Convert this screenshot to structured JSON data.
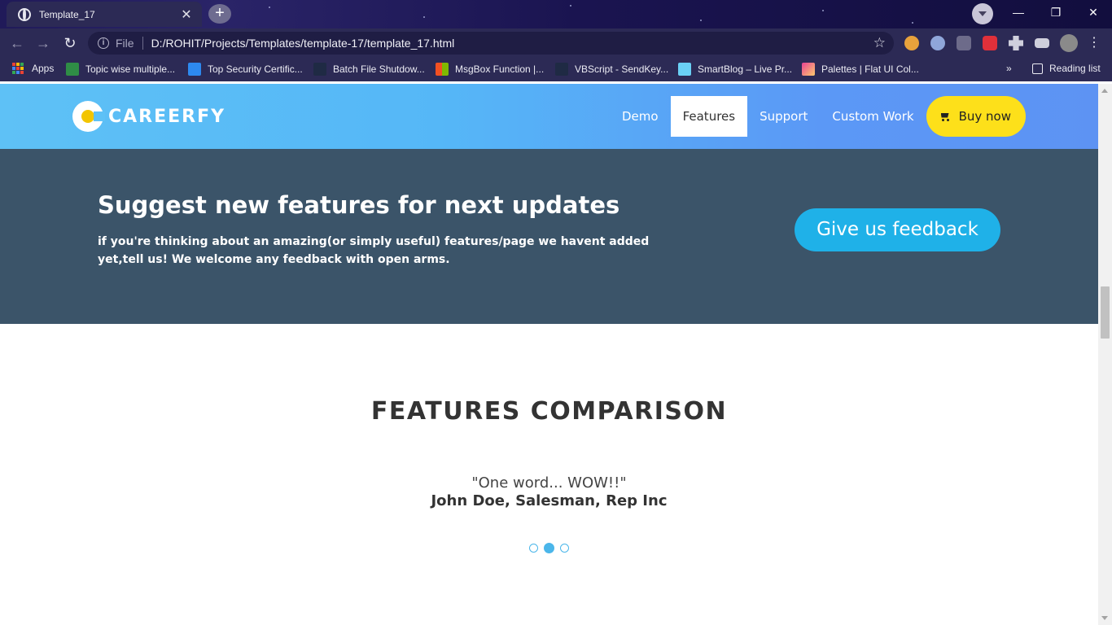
{
  "browser": {
    "tab_title": "Template_17",
    "tab_close": "✕",
    "new_tab": "+",
    "omnibox_file": "File",
    "url": "D:/ROHIT/Projects/Templates/template-17/template_17.html",
    "window_controls": [
      "—",
      "❐",
      "✕"
    ],
    "bookmarks": [
      {
        "label": "Apps",
        "icon": "apps-grid-icon",
        "color": "#e94235"
      },
      {
        "label": "Topic wise multiple...",
        "icon": "gfg-icon",
        "color": "#2f8d46"
      },
      {
        "label": "Top Security Certific...",
        "icon": "certificate-icon",
        "color": "#2d89ef"
      },
      {
        "label": "Batch File Shutdow...",
        "icon": "file-icon",
        "color": "#1f2a44"
      },
      {
        "label": "MsgBox Function |...",
        "icon": "microsoft-icon",
        "color": "#f25022"
      },
      {
        "label": "VBScript - SendKey...",
        "icon": "script-icon",
        "color": "#1f2a44"
      },
      {
        "label": "SmartBlog – Live Pr...",
        "icon": "smartblog-icon",
        "color": "#6ad0f5"
      },
      {
        "label": "Palettes | Flat UI Col...",
        "icon": "palette-icon",
        "color": "#e84393"
      }
    ],
    "more_bookmarks": "»",
    "reading_list": "Reading list"
  },
  "site": {
    "logo_text": "CAREERFY",
    "nav": [
      {
        "label": "Demo",
        "active": false
      },
      {
        "label": "Features",
        "active": true
      },
      {
        "label": "Support",
        "active": false
      },
      {
        "label": "Custom Work",
        "active": false
      }
    ],
    "buy_label": "Buy now"
  },
  "feedback": {
    "title": "Suggest new features for next updates",
    "description": "if you're thinking about an amazing(or simply useful) features/page we havent added yet,tell us! We welcome any feedback with open arms.",
    "button": "Give us feedback"
  },
  "features": {
    "title": "FEATURES COMPARISON",
    "quote": "\"One word... WOW!!\"",
    "author": "John Doe, Salesman, Rep Inc",
    "carousel_active_index": 1,
    "carousel_count": 3
  },
  "colors": {
    "header_gradient_start": "#5ec1f6",
    "header_gradient_end": "#5d93f3",
    "feedback_bg": "#3b5469",
    "feedback_button": "#1fb1e8",
    "buy_button": "#fde01a",
    "carousel_dot": "#4bb6ea"
  }
}
